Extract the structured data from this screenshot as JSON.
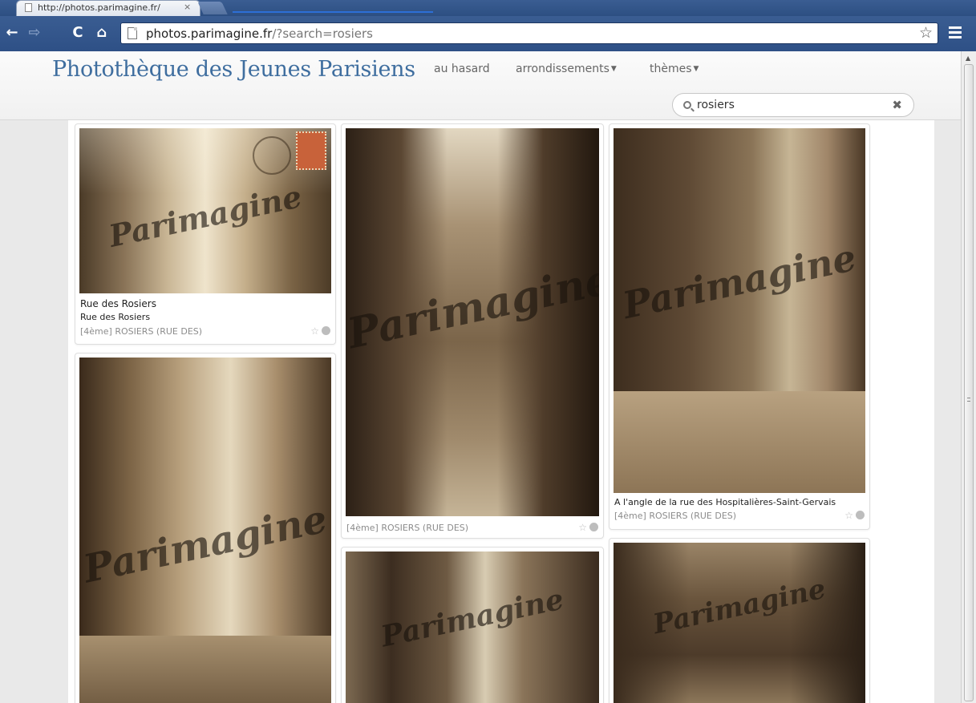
{
  "browser": {
    "tab_title": "http://photos.parimagine.fr/",
    "tab_close": "×",
    "url_host": "photos.parimagine.fr",
    "url_rest": "/?search=rosiers",
    "bookmark_star": "☆"
  },
  "site": {
    "brand": "Photothèque des Jeunes Parisiens",
    "nav": {
      "random": "au hasard",
      "districts": "arrondissements",
      "themes": "thèmes"
    },
    "search": {
      "value": "rosiers",
      "clear": "✖"
    }
  },
  "watermark": "Parimagine",
  "cards": [
    {
      "title": "Rue des Rosiers",
      "subtitle": "Rue des Rosiers",
      "location": "[4ème] ROSIERS (RUE DES)"
    },
    {
      "location": "[4ème] ROSIERS (RUE DES)"
    },
    {
      "title": "A l'angle de la rue des Hospitalières-Saint-Gervais",
      "location": "[4ème] ROSIERS (RUE DES)"
    }
  ],
  "card_icon_star": "☆",
  "colors": {
    "brand": "#3f6e9f",
    "chrome": "#2e5086"
  }
}
